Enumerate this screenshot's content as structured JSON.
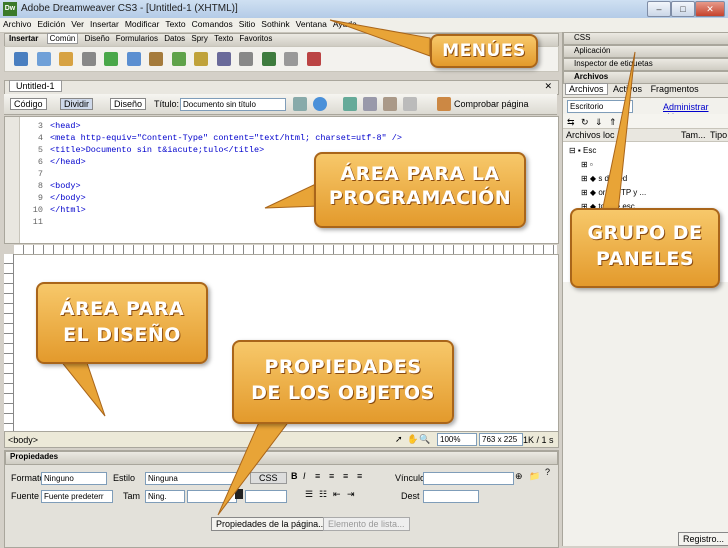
{
  "window": {
    "title": "Adobe Dreamweaver CS3 - [Untitled-1 (XHTML)]",
    "logo": "Dw"
  },
  "menu": [
    "Archivo",
    "Edición",
    "Ver",
    "Insertar",
    "Modificar",
    "Texto",
    "Comandos",
    "Sitio",
    "Sothink",
    "Ventana",
    "Ayuda"
  ],
  "insert_bar": {
    "label": "Insertar",
    "tabs": [
      "Común",
      "Diseño",
      "Formularios",
      "Datos",
      "Spry",
      "Texto",
      "Favoritos"
    ]
  },
  "document": {
    "tab": "Untitled-1",
    "views": [
      "Código",
      "Dividir",
      "Diseño"
    ],
    "title_label": "Título:",
    "title_value": "Documento sin título",
    "check_page": "Comprobar página"
  },
  "code_lines": [
    {
      "n": "3",
      "text": "<head>"
    },
    {
      "n": "4",
      "text": "<meta http-equiv=\"Content-Type\" content=\"text/html; charset=utf-8\" />"
    },
    {
      "n": "5",
      "text": "<title>Documento sin t&iacute;tulo</title>"
    },
    {
      "n": "6",
      "text": "</head>"
    },
    {
      "n": "7",
      "text": ""
    },
    {
      "n": "8",
      "text": "<body>"
    },
    {
      "n": "9",
      "text": "</body>"
    },
    {
      "n": "10",
      "text": "</html>"
    },
    {
      "n": "11",
      "text": ""
    }
  ],
  "status": {
    "tag": "<body>",
    "zoom": "100%",
    "size": "763 x 225",
    "weight": "1K / 1 s"
  },
  "properties": {
    "title": "Propiedades",
    "format_label": "Formato",
    "format_value": "Ninguno",
    "style_label": "Estilo",
    "style_value": "Ninguna",
    "css_button": "CSS",
    "link_label": "Vínculo",
    "font_label": "Fuente",
    "font_value": "Fuente predeterr",
    "size_label": "Tam",
    "size_value": "Ning.",
    "dest_label": "Dest",
    "page_props_button": "Propiedades de la página...",
    "list_item_button": "Elemento de lista..."
  },
  "panels": {
    "css": "CSS",
    "app": "Aplicación",
    "tag_inspector": "Inspector de etiquetas",
    "files_group": "Archivos",
    "tabs": [
      "Archivos",
      "Activos",
      "Fragmentos"
    ],
    "site_select": "Escritorio",
    "manage_sites": "Administrar sitios",
    "columns": [
      "Archivos loc",
      "Tam...",
      "Tipo"
    ],
    "tree": [
      "Esc",
      "s de red",
      "ores FTP y ...",
      "tos de esc..."
    ],
    "register_button": "Registro..."
  },
  "callouts": {
    "menus": "MENÚES",
    "code_area": [
      "ÁREA PARA LA",
      "PROGRAMACIÓN"
    ],
    "panels": [
      "GRUPO DE",
      "PANELES"
    ],
    "design_area": [
      "ÁREA PARA",
      "EL DISEÑO"
    ],
    "props": [
      "PROPIEDADES",
      "DE LOS OBJETOS"
    ]
  },
  "colors": {
    "callout": "#e8a437",
    "callout_border": "#a9651a",
    "tag_blue": "#0000cc"
  }
}
